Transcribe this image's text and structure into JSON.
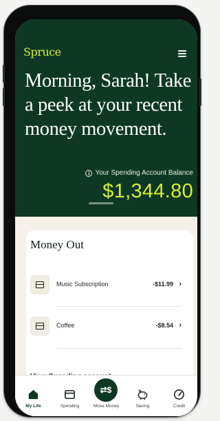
{
  "app": {
    "brand": "Spruce"
  },
  "header": {
    "greeting": "Morning, Sarah! Take a peek at your recent money movement.",
    "balance_label": "Your Spending Account Balance",
    "balance_amount": "$1,344.80"
  },
  "money_out": {
    "title": "Money Out",
    "items": [
      {
        "label": "Music Subscription",
        "amount": "-$11.99",
        "icon": "card-icon"
      },
      {
        "label": "Coffee",
        "amount": "-$8.54",
        "icon": "card-icon"
      }
    ],
    "view_link": "View Spending account"
  },
  "tabs": [
    {
      "label": "My Life",
      "icon": "home-icon",
      "active": true
    },
    {
      "label": "Spending",
      "icon": "card-icon"
    },
    {
      "label": "Move Money",
      "icon": "transfer-icon",
      "glyph": "⇄$"
    },
    {
      "label": "Saving",
      "icon": "piggy-bank-icon"
    },
    {
      "label": "Credit",
      "icon": "gauge-icon"
    }
  ],
  "colors": {
    "brand_green": "#0e3823",
    "accent_lime": "#d6ee35",
    "card_bg": "#ffffff",
    "page_bg": "#f5f1e9"
  }
}
